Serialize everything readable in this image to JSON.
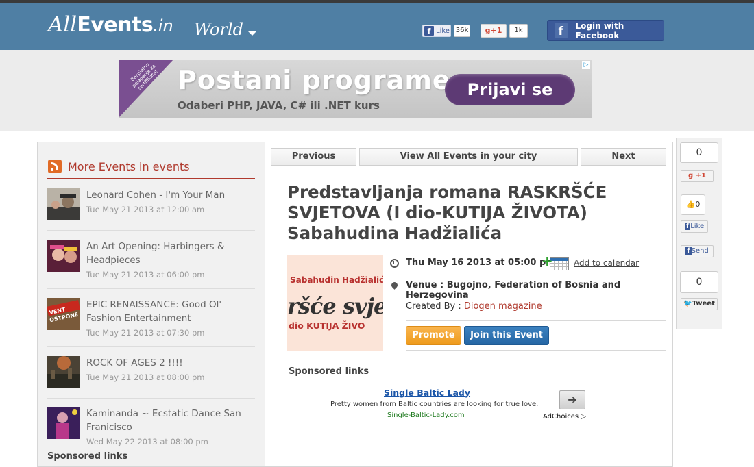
{
  "header": {
    "logo_all": "All",
    "logo_events": "Events",
    "logo_in": ".in",
    "location": "World",
    "fb_like_label": "Like",
    "fb_like_count": "36k",
    "gplus_label": "+1",
    "gplus_count": "1k",
    "login_facebook": "Login with Facebook"
  },
  "ad_banner": {
    "ribbon_text": "Besplatno polaganje za sertifikate!",
    "title": "Postani programer",
    "subtitle": "Odaberi PHP, JAVA, C# ili .NET kurs",
    "button": "Prijavi se"
  },
  "sidebar": {
    "title": "More Events in events",
    "items": [
      {
        "title": "Leonard Cohen - I'm Your Man",
        "time": "Tue May 21 2013 at 12:00 am"
      },
      {
        "title": "An Art Opening: Harbingers & Headpieces",
        "time": "Tue May 21 2013 at 06:00 pm"
      },
      {
        "title": "EPIC RENAISSANCE: Good Ol' Fashion Entertainment",
        "time": "Tue May 21 2013 at 07:30 pm"
      },
      {
        "title": "ROCK OF AGES 2 !!!!",
        "time": "Tue May 21 2013 at 08:00 pm"
      },
      {
        "title": "Kaminanda ~ Ecstatic Dance San Franicisco",
        "time": "Wed May 22 2013 at 08:00 pm"
      }
    ],
    "sponsored": "Sponsored links"
  },
  "nav": {
    "previous": "Previous",
    "view_all": "View All Events in your city",
    "next": "Next"
  },
  "event": {
    "title": "Predstavljanja romana RASKRŠĆE SVJETOVA (I dio-KUTIJA ŽIVOTA) Sabahudina Hadžialića",
    "image_author": "Sabahudin Hadžialić",
    "image_big": "ršće svje",
    "image_sub": "dio KUTIJA ŽIVO",
    "date": "Thu May 16 2013 at 05:00 pm",
    "add_to_calendar": "Add to calendar",
    "venue": "Venue : Bugojno, Federation of Bosnia and Herzegovina",
    "created_by_label": "Created By : ",
    "created_by": "Diogen magazine",
    "promote": "Promote",
    "join": "Join this Event"
  },
  "sponsored_center": {
    "heading": "Sponsored links",
    "link": "Single Baltic Lady",
    "description": "Pretty women from Baltic countries are looking for true love.",
    "url": "Single-Baltic-Lady.com",
    "adchoices": "AdChoices"
  },
  "share": {
    "gplus_count": "0",
    "gplus_label": "+1",
    "fb_count": "0",
    "fb_like": "Like",
    "fb_send": "Send",
    "tweet_count": "0",
    "tweet": "Tweet"
  },
  "colors": {
    "header_bg": "#4f7fa4",
    "accent_red": "#b03a2e",
    "facebook_blue": "#3b5a99",
    "promote_orange": "#ee9b1c",
    "join_blue": "#2566a4"
  }
}
